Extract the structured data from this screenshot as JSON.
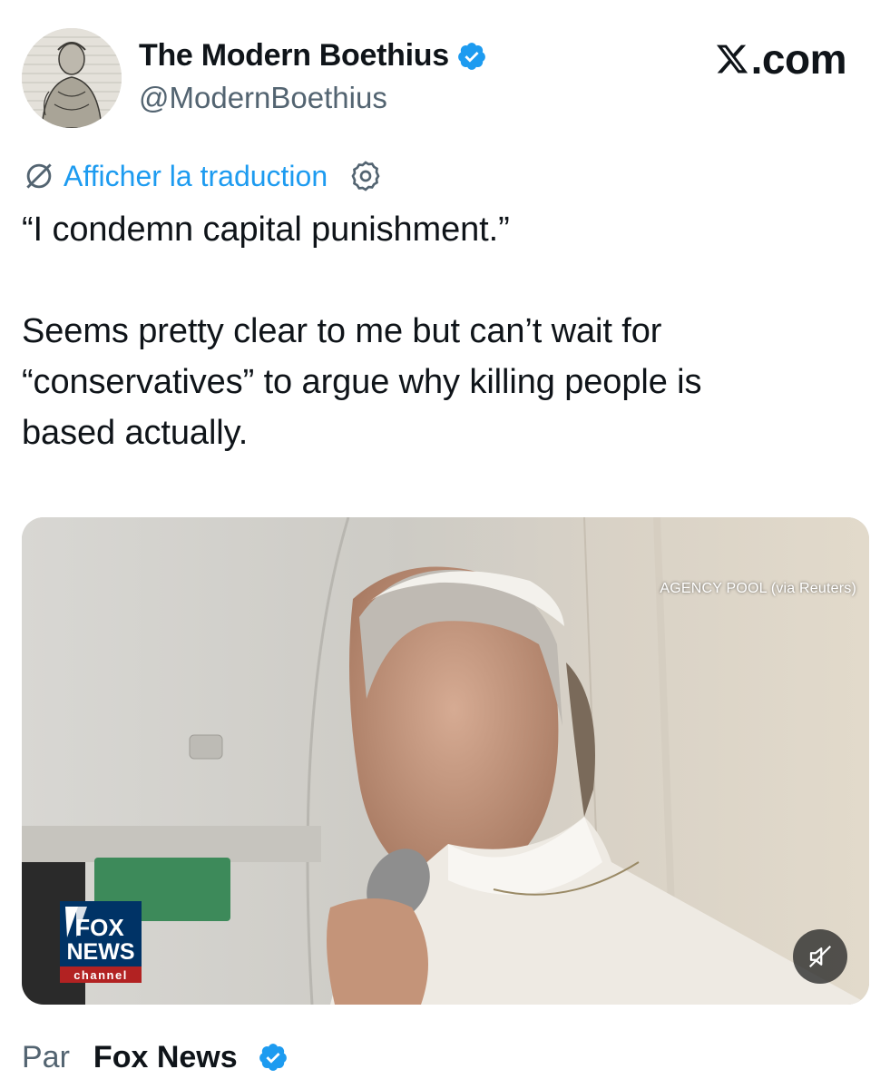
{
  "header": {
    "display_name": "The Modern Boethius",
    "handle": "@ModernBoethius",
    "verified": true,
    "site_label": "X.com"
  },
  "translation": {
    "label": "Afficher la traduction"
  },
  "tweet": {
    "text": "“I condemn capital punishment.”\n\nSeems pretty clear to me but can’t wait for\n“conservatives” to argue why killing people is\nbased actually."
  },
  "media": {
    "credit": "AGENCY POOL (via Reuters)",
    "logo_text": [
      "FOX",
      "NEWS",
      "channel"
    ],
    "mute_icon": "speaker-muted-icon"
  },
  "footer": {
    "prefix": "Par",
    "source_name": "Fox News",
    "verified": true
  },
  "colors": {
    "accent_blue": "#1d9bf0",
    "text_primary": "#0f1419",
    "text_secondary": "#536471"
  }
}
